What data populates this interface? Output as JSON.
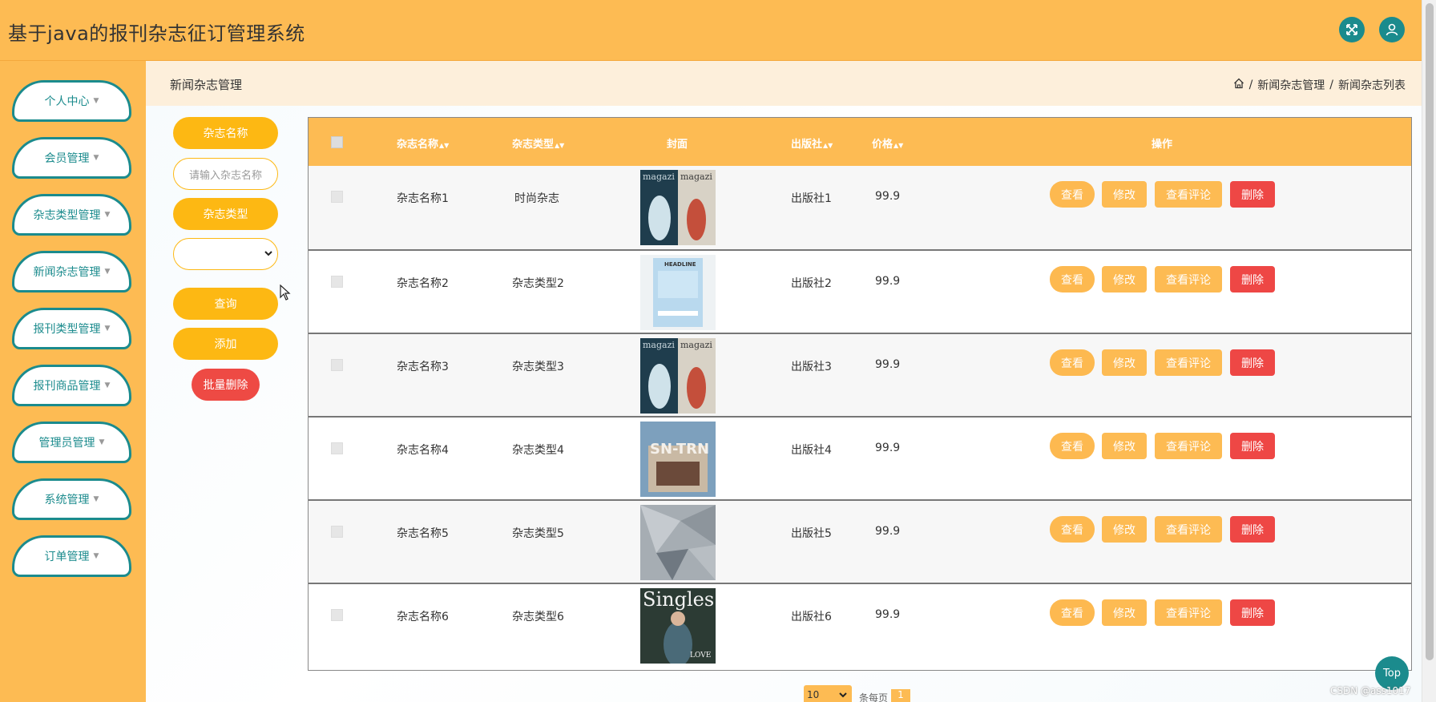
{
  "header": {
    "title": "基于java的报刊杂志征订管理系统"
  },
  "sidebar": {
    "items": [
      {
        "label": "个人中心"
      },
      {
        "label": "会员管理"
      },
      {
        "label": "杂志类型管理"
      },
      {
        "label": "新闻杂志管理"
      },
      {
        "label": "报刊类型管理"
      },
      {
        "label": "报刊商品管理"
      },
      {
        "label": "管理员管理"
      },
      {
        "label": "系统管理"
      },
      {
        "label": "订单管理"
      }
    ]
  },
  "page": {
    "title": "新闻杂志管理",
    "breadcrumb": [
      "新闻杂志管理",
      "新闻杂志列表"
    ]
  },
  "filters": {
    "name_label": "杂志名称",
    "name_placeholder": "请输入杂志名称",
    "type_label": "杂志类型",
    "type_value": "",
    "search_label": "查询",
    "add_label": "添加",
    "batch_delete_label": "批量删除"
  },
  "table": {
    "headers": {
      "name": "杂志名称",
      "type": "杂志类型",
      "cover": "封面",
      "publisher": "出版社",
      "price": "价格",
      "actions": "操作"
    },
    "rows": [
      {
        "name": "杂志名称1",
        "type": "时尚杂志",
        "publisher": "出版社1",
        "price": "99.9"
      },
      {
        "name": "杂志名称2",
        "type": "杂志类型2",
        "publisher": "出版社2",
        "price": "99.9"
      },
      {
        "name": "杂志名称3",
        "type": "杂志类型3",
        "publisher": "出版社3",
        "price": "99.9"
      },
      {
        "name": "杂志名称4",
        "type": "杂志类型4",
        "publisher": "出版社4",
        "price": "99.9"
      },
      {
        "name": "杂志名称5",
        "type": "杂志类型5",
        "publisher": "出版社5",
        "price": "99.9"
      },
      {
        "name": "杂志名称6",
        "type": "杂志类型6",
        "publisher": "出版社6",
        "price": "99.9"
      }
    ],
    "actions": {
      "view": "查看",
      "edit": "修改",
      "comments": "查看评论",
      "delete": "删除"
    }
  },
  "pager": {
    "page_size": "10",
    "per_page_text": "条每页",
    "current_page": "1"
  },
  "top_button": "Top",
  "watermark": "CSDN @ass1017",
  "colors": {
    "primary": "#fdbb53",
    "teal": "#1b8b8d",
    "danger": "#ee4745",
    "gold": "#fdb813"
  }
}
